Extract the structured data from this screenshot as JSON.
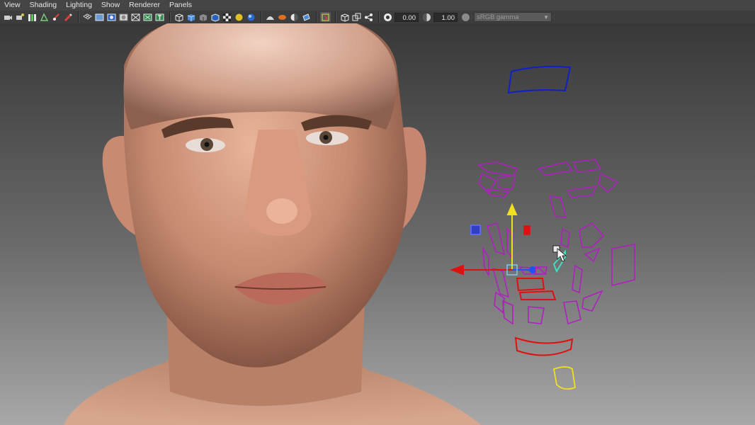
{
  "menubar": {
    "items": [
      "View",
      "Shading",
      "Lighting",
      "Show",
      "Renderer",
      "Panels"
    ]
  },
  "toolbar": {
    "exposure_value": "0.00",
    "gamma_value": "1.00",
    "color_space_selected": "sRGB gamma",
    "icons": [
      "camera-select-icon",
      "camera-attributes-icon",
      "bookmark-icon",
      "image-plane-icon",
      "two-d-pan-icon",
      "grease-pencil-icon",
      "grid-icon",
      "film-gate-icon",
      "resolution-gate-icon",
      "gate-mask-icon",
      "field-chart-icon",
      "safe-action-icon",
      "safe-title-icon",
      "wireframe-icon",
      "smooth-shade-icon",
      "use-default-material-icon",
      "wireframe-on-shaded-icon",
      "textured-icon",
      "use-all-lights-icon",
      "shadows-icon",
      "screen-space-ao-icon",
      "motion-blur-icon",
      "multisample-aa-icon",
      "depth-of-field-icon",
      "isolate-select-icon",
      "xray-icon",
      "xray-active-components-icon",
      "xray-joints-icon",
      "exposure-icon",
      "gamma-icon",
      "color-management-icon"
    ],
    "accent_colors": {
      "panel": "#454545",
      "toolbar": "#3d3d3d",
      "curve_magenta": "#b020c0",
      "curve_blue": "#1020c8",
      "curve_red": "#e01010",
      "curve_yellow": "#f0e020"
    }
  },
  "viewport": {
    "scene_objects": [
      "head-model",
      "face-rig-controls"
    ]
  }
}
